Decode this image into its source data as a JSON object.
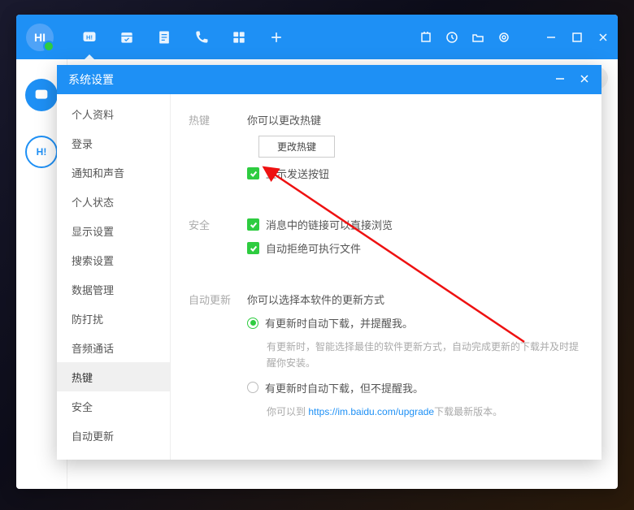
{
  "avatar_text": "HI",
  "dialog": {
    "title": "系统设置",
    "sidebar": [
      "个人资料",
      "登录",
      "通知和声音",
      "个人状态",
      "显示设置",
      "搜索设置",
      "数据管理",
      "防打扰",
      "音频通话",
      "热键",
      "安全",
      "自动更新"
    ],
    "active_index": 9
  },
  "hotkey": {
    "section_label": "热键",
    "hint": "你可以更改热键",
    "button": "更改热键",
    "show_send": "显示发送按钮"
  },
  "security": {
    "section_label": "安全",
    "link_preview": "消息中的链接可以直接浏览",
    "reject_exe": "自动拒绝可执行文件"
  },
  "update": {
    "section_label": "自动更新",
    "hint": "你可以选择本软件的更新方式",
    "opt1": "有更新时自动下载，并提醒我。",
    "opt1_desc": "有更新时，智能选择最佳的软件更新方式，自动完成更新的下载并及时提醒你安装。",
    "opt2": "有更新时自动下载，但不提醒我。",
    "opt2_desc_pre": "你可以到 ",
    "opt2_url": "https://im.baidu.com/upgrade",
    "opt2_desc_post": "下载最新版本。"
  }
}
